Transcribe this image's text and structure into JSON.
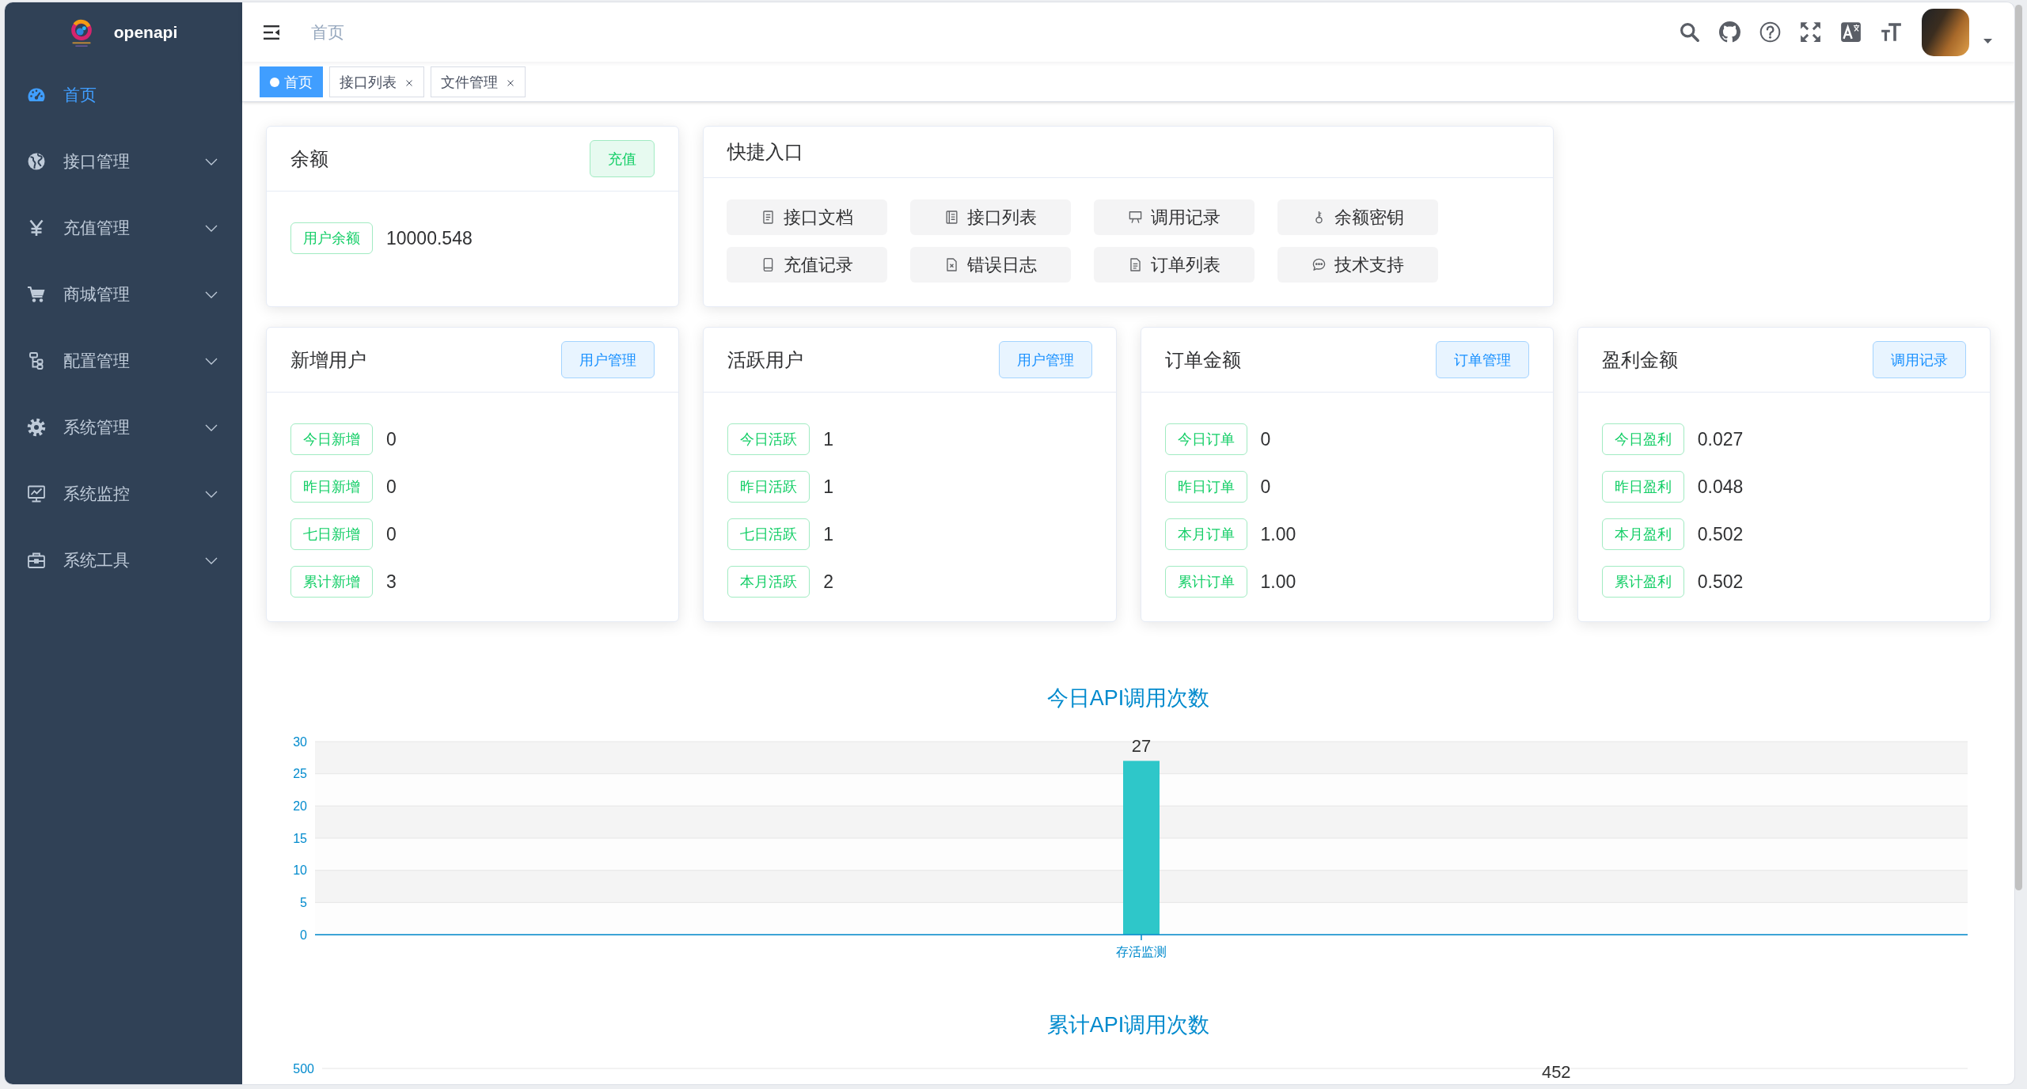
{
  "sidebar": {
    "title": "openapi",
    "items": [
      {
        "label": "首页",
        "kind": "link",
        "selected": true
      },
      {
        "label": "接口管理",
        "kind": "submenu",
        "selected": false
      },
      {
        "label": "充值管理",
        "kind": "submenu",
        "selected": false
      },
      {
        "label": "商城管理",
        "kind": "submenu",
        "selected": false
      },
      {
        "label": "配置管理",
        "kind": "submenu",
        "selected": false
      },
      {
        "label": "系统管理",
        "kind": "submenu",
        "selected": false
      },
      {
        "label": "系统监控",
        "kind": "submenu",
        "selected": false
      },
      {
        "label": "系统工具",
        "kind": "submenu",
        "selected": false
      }
    ]
  },
  "navbar": {
    "breadcrumb": [
      "首页"
    ]
  },
  "tags": [
    {
      "label": "首页",
      "selected": true,
      "closable": false
    },
    {
      "label": "接口列表",
      "selected": false,
      "closable": true
    },
    {
      "label": "文件管理",
      "selected": false,
      "closable": true
    }
  ],
  "balance_card": {
    "title": "余额",
    "button": {
      "label": "充值",
      "kind": "success"
    },
    "rows": [
      {
        "label": "用户余额",
        "value": "10000.548"
      }
    ]
  },
  "quick_links": {
    "title": "快捷入口",
    "items": [
      "接口文档",
      "接口列表",
      "调用记录",
      "余额密钥",
      "充值记录",
      "错误日志",
      "订单列表",
      "技术支持"
    ]
  },
  "stat_cards": [
    {
      "title": "新增用户",
      "button": {
        "label": "用户管理",
        "kind": "primary"
      },
      "rows": [
        {
          "label": "今日新增",
          "value": "0"
        },
        {
          "label": "昨日新增",
          "value": "0"
        },
        {
          "label": "七日新增",
          "value": "0"
        },
        {
          "label": "累计新增",
          "value": "3"
        }
      ]
    },
    {
      "title": "活跃用户",
      "button": {
        "label": "用户管理",
        "kind": "primary"
      },
      "rows": [
        {
          "label": "今日活跃",
          "value": "1"
        },
        {
          "label": "昨日活跃",
          "value": "1"
        },
        {
          "label": "七日活跃",
          "value": "1"
        },
        {
          "label": "本月活跃",
          "value": "2"
        }
      ]
    },
    {
      "title": "订单金额",
      "button": {
        "label": "订单管理",
        "kind": "primary"
      },
      "rows": [
        {
          "label": "今日订单",
          "value": "0"
        },
        {
          "label": "昨日订单",
          "value": "0"
        },
        {
          "label": "本月订单",
          "value": "1.00"
        },
        {
          "label": "累计订单",
          "value": "1.00"
        }
      ]
    },
    {
      "title": "盈利金额",
      "button": {
        "label": "调用记录",
        "kind": "primary"
      },
      "rows": [
        {
          "label": "今日盈利",
          "value": "0.027"
        },
        {
          "label": "昨日盈利",
          "value": "0.048"
        },
        {
          "label": "本月盈利",
          "value": "0.502"
        },
        {
          "label": "累计盈利",
          "value": "0.502"
        }
      ]
    }
  ],
  "today_chart": {
    "chart_data": {
      "type": "bar",
      "title": "今日API调用次数",
      "categories": [
        "存活监测"
      ],
      "series": [
        {
          "color": "#2ec7c9",
          "values": [
            27
          ]
        }
      ],
      "ylim": [
        0,
        30
      ],
      "yticks": [
        0,
        5,
        10,
        15,
        20,
        25,
        30
      ],
      "grid": true,
      "data_labels": true
    }
  },
  "total_chart": {
    "title": "累计API调用次数",
    "y_axis_label": "500",
    "value_label": "452"
  }
}
